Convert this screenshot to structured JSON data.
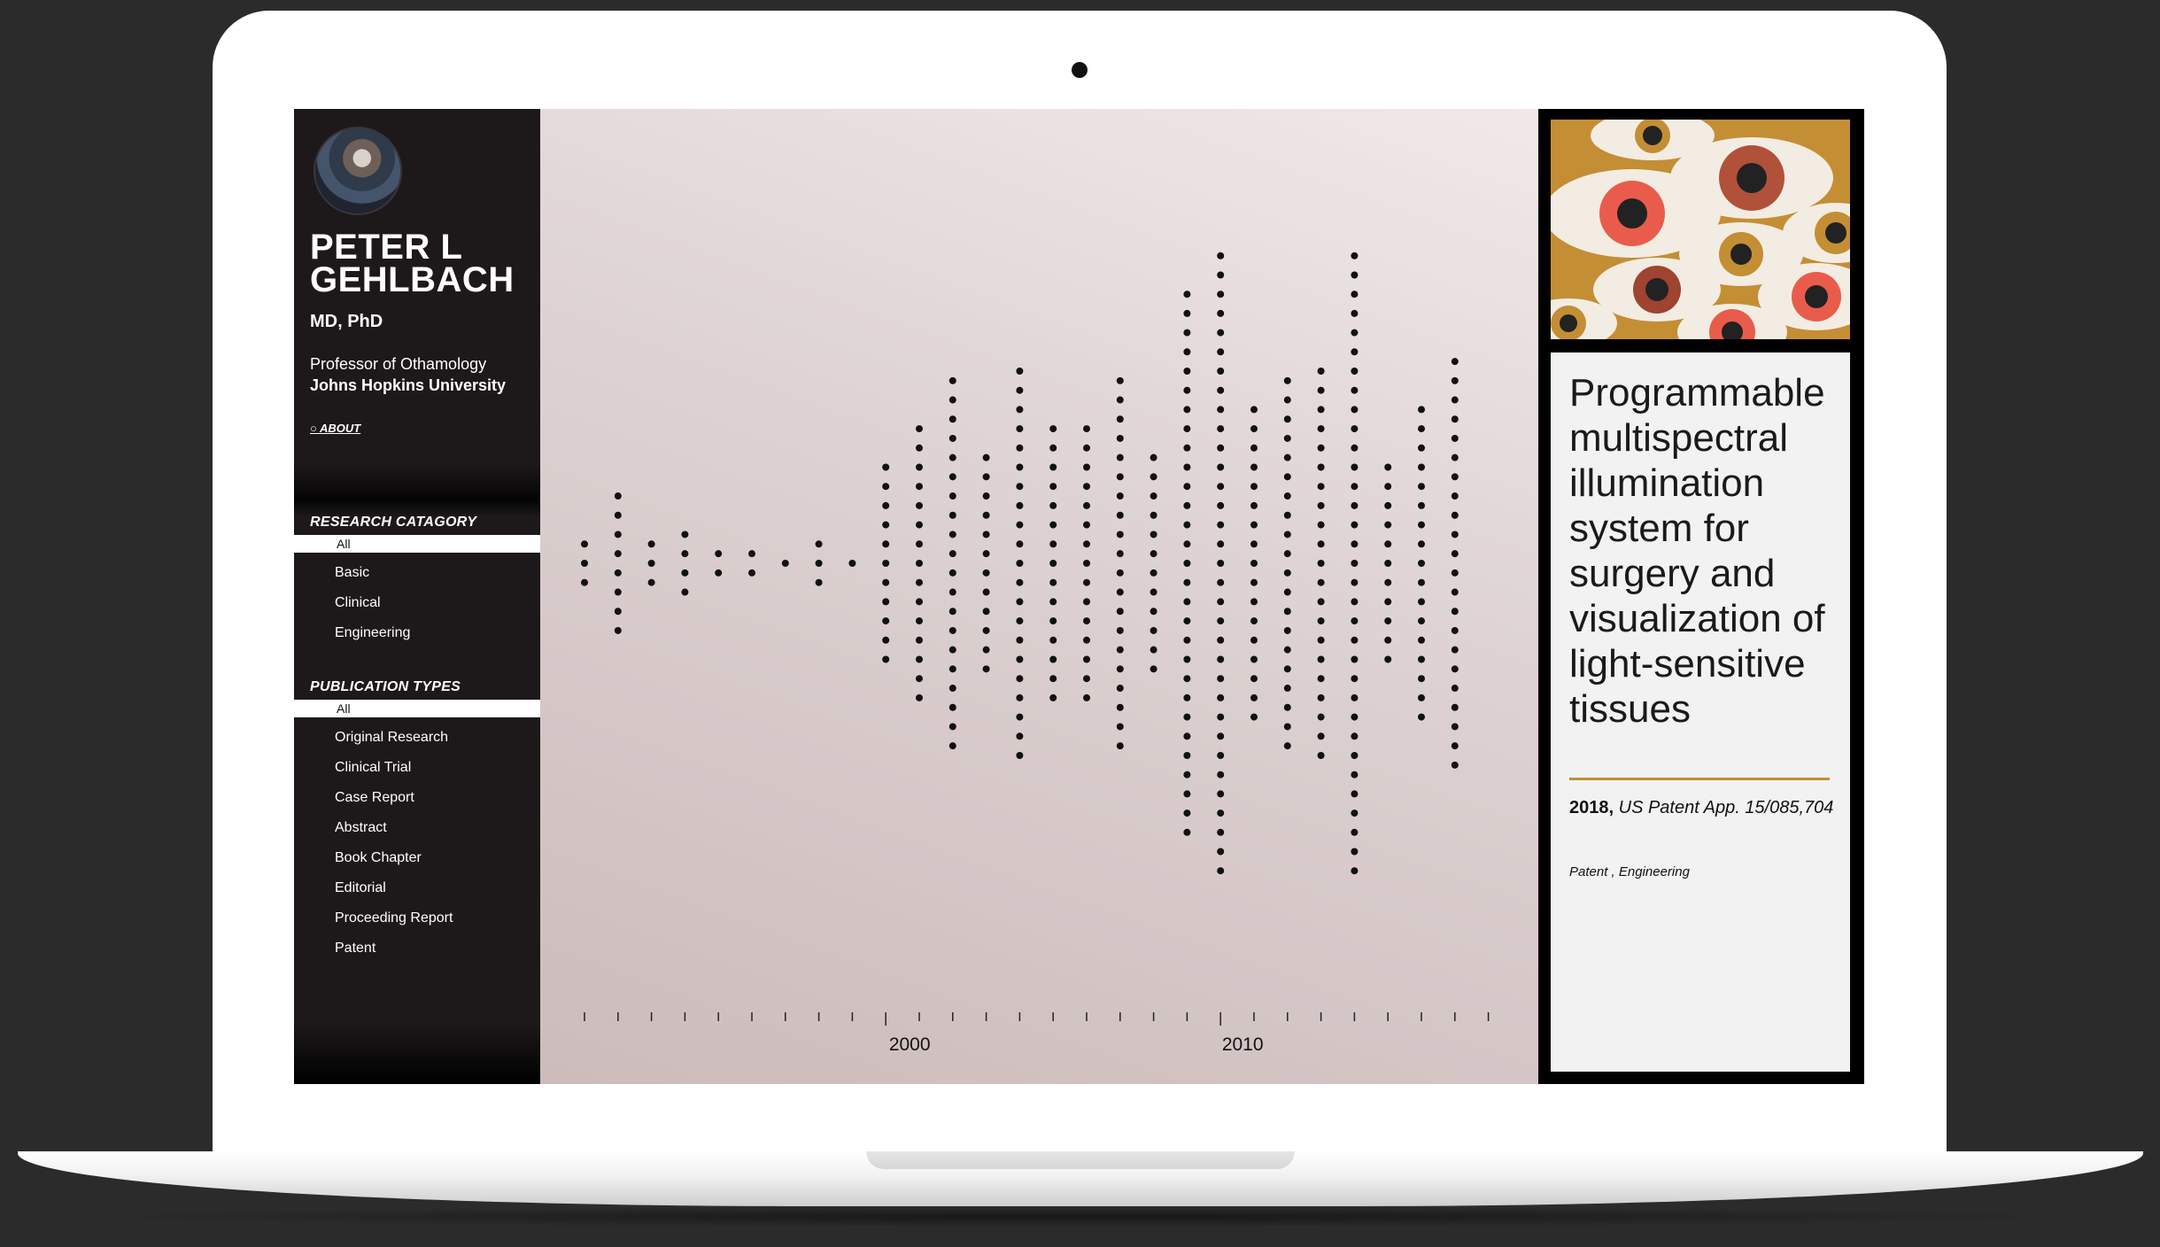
{
  "profile": {
    "name": "PETER L GEHLBACH",
    "degree": "MD, PhD",
    "title": "Professor of Othamology",
    "university": "Johns Hopkins University",
    "about_label": "○ ABOUT"
  },
  "research_category": {
    "header": "RESEARCH CATAGORY",
    "all_label": "All",
    "items": [
      "Basic",
      "Clinical",
      "Engineering"
    ]
  },
  "publication_types": {
    "header": "PUBLICATION TYPES",
    "all_label": "All",
    "items": [
      "Original Research",
      "Clinical Trial",
      "Case Report",
      "Abstract",
      "Book Chapter",
      "Editorial",
      "Proceeding Report",
      "Patent"
    ]
  },
  "timeline": {
    "year_labels": [
      "2000",
      "2010"
    ],
    "dot_columns": [
      {
        "year": 1991,
        "count": 3
      },
      {
        "year": 1992,
        "count": 8
      },
      {
        "year": 1993,
        "count": 3
      },
      {
        "year": 1994,
        "count": 4
      },
      {
        "year": 1995,
        "count": 2
      },
      {
        "year": 1996,
        "count": 2
      },
      {
        "year": 1997,
        "count": 1
      },
      {
        "year": 1998,
        "count": 3
      },
      {
        "year": 1999,
        "count": 1
      },
      {
        "year": 2000,
        "count": 11
      },
      {
        "year": 2001,
        "count": 15
      },
      {
        "year": 2002,
        "count": 20
      },
      {
        "year": 2003,
        "count": 12
      },
      {
        "year": 2004,
        "count": 21
      },
      {
        "year": 2005,
        "count": 15
      },
      {
        "year": 2006,
        "count": 15
      },
      {
        "year": 2007,
        "count": 20
      },
      {
        "year": 2008,
        "count": 12
      },
      {
        "year": 2009,
        "count": 29
      },
      {
        "year": 2010,
        "count": 33
      },
      {
        "year": 2011,
        "count": 17
      },
      {
        "year": 2012,
        "count": 20
      },
      {
        "year": 2013,
        "count": 21
      },
      {
        "year": 2014,
        "count": 33
      },
      {
        "year": 2015,
        "count": 11
      },
      {
        "year": 2016,
        "count": 17
      },
      {
        "year": 2017,
        "count": 22
      }
    ]
  },
  "detail": {
    "title": "Programmable multispectral illumination system for surgery and visualization of light-sensitive tissues",
    "year": "2018,",
    "source": "US Patent App. 15/085,704",
    "tags": "Patent , Engineering"
  },
  "colors": {
    "accent": "#c48e35",
    "sidebar_bg": "#1d191a",
    "dot": "#111111"
  }
}
